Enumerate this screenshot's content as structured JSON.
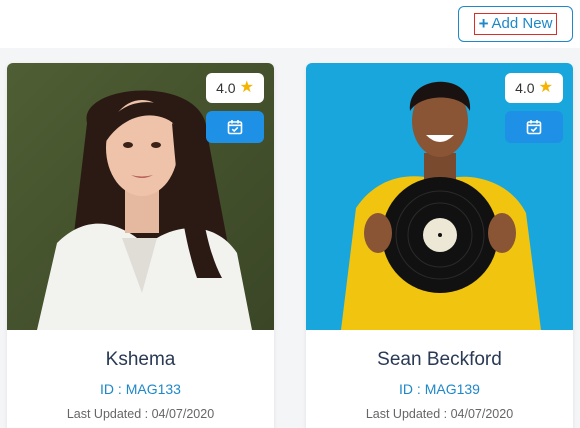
{
  "toolbar": {
    "add_label": "Add New"
  },
  "cards": [
    {
      "name": "Kshema",
      "id_text": "ID : MAG133",
      "updated_text": "Last Updated : 04/07/2020",
      "rating": "4.0"
    },
    {
      "name": "Sean Beckford",
      "id_text": "ID : MAG139",
      "updated_text": "Last Updated : 04/07/2020",
      "rating": "4.0"
    }
  ],
  "colors": {
    "accent": "#1e88c8",
    "calendar_button": "#1e90e6",
    "star": "#f4b400"
  },
  "icons": {
    "add": "plus-icon",
    "rating": "star-icon",
    "schedule": "calendar-check-icon"
  }
}
